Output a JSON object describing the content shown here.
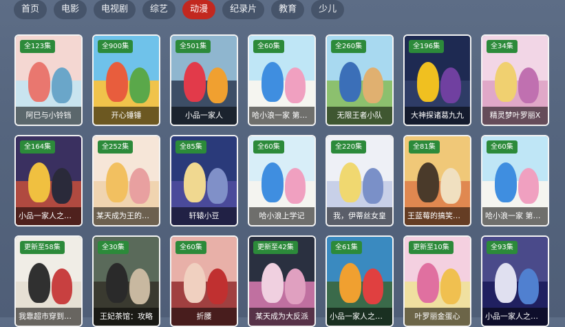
{
  "nav": {
    "tabs": [
      {
        "label": "首页"
      },
      {
        "label": "电影"
      },
      {
        "label": "电视剧"
      },
      {
        "label": "综艺"
      },
      {
        "label": "动漫",
        "active": true
      },
      {
        "label": "纪录片"
      },
      {
        "label": "教育"
      },
      {
        "label": "少儿"
      }
    ]
  },
  "accent_color": "#c2281f",
  "badge_color": "#2c8a3a",
  "cards": [
    {
      "badge": "全123集",
      "title": "阿巳与小铃铛",
      "sky": "#f4d7d2",
      "ground": "#c9e4ef",
      "f1": "#e9776f",
      "f2": "#6aa6c9"
    },
    {
      "badge": "全900集",
      "title": "开心锤锤",
      "sky": "#6fc2ea",
      "ground": "#f0c34b",
      "f1": "#e85d3d",
      "f2": "#5aa84a"
    },
    {
      "badge": "全501集",
      "title": "小品一家人",
      "sky": "#8fb6cf",
      "ground": "#3d4e66",
      "f1": "#e23a4a",
      "f2": "#f0a030"
    },
    {
      "badge": "全60集",
      "title": "哈小浪一家 第三季",
      "sky": "#bfe6f6",
      "ground": "#f5f5f0",
      "f1": "#3f8ee0",
      "f2": "#f0a0c0"
    },
    {
      "badge": "全260集",
      "title": "无限王者小队",
      "sky": "#a8d9f0",
      "ground": "#8cc06e",
      "f1": "#3b6fb8",
      "f2": "#e0b070"
    },
    {
      "badge": "全196集",
      "title": "大神探诸葛九九",
      "sky": "#1e2a52",
      "ground": "#2e3c66",
      "f1": "#f0c020",
      "f2": "#7040a0"
    },
    {
      "badge": "全34集",
      "title": "精灵梦叶罗丽X",
      "sky": "#f2d6e6",
      "ground": "#e0a8c8",
      "f1": "#f0d070",
      "f2": "#c070b0"
    },
    {
      "badge": "全164集",
      "title": "小品一家人之奇幻冒险",
      "sky": "#3a3060",
      "ground": "#b04a40",
      "f1": "#f0c040",
      "f2": "#2a2a3a"
    },
    {
      "badge": "全252集",
      "title": "某天成为王的女儿",
      "sky": "#f6e6d8",
      "ground": "#f0d4b0",
      "f1": "#f2c060",
      "f2": "#e8a0a0"
    },
    {
      "badge": "全85集",
      "title": "轩辕小豆",
      "sky": "#2a3a7a",
      "ground": "#4a4a9a",
      "f1": "#f0d890",
      "f2": "#8090c8"
    },
    {
      "badge": "全60集",
      "title": "哈小浪上学记",
      "sky": "#d8eef8",
      "ground": "#f4f4f0",
      "f1": "#3f8ee0",
      "f2": "#f0a0c0"
    },
    {
      "badge": "全220集",
      "title": "我，伊蒂丝女皇",
      "sky": "#eef0f6",
      "ground": "#c8d0e8",
      "f1": "#f0d870",
      "f2": "#7a90c8"
    },
    {
      "badge": "全81集",
      "title": "王蓝莓的搞笑日常",
      "sky": "#f0c878",
      "ground": "#e08850",
      "f1": "#4a3a2a",
      "f2": "#f0e0c0"
    },
    {
      "badge": "全60集",
      "title": "哈小浪一家 第二季",
      "sky": "#bfe6f6",
      "ground": "#f5f5f0",
      "f1": "#3f8ee0",
      "f2": "#f0a0c0"
    },
    {
      "badge": "更新至58集",
      "title": "我靠超市穿到古代",
      "sky": "#f0ede6",
      "ground": "#e6e0d4",
      "f1": "#303030",
      "f2": "#c84040"
    },
    {
      "badge": "全30集",
      "title": "王妃茶馆：攻略",
      "sky": "#5a6a5a",
      "ground": "#3a3a30",
      "f1": "#2a2a2a",
      "f2": "#c8b8a0"
    },
    {
      "badge": "全60集",
      "title": "折腰",
      "sky": "#e8b0a8",
      "ground": "#a04040",
      "f1": "#f0d0c0",
      "f2": "#c03030"
    },
    {
      "badge": "更新至42集",
      "title": "某天成为大反派",
      "sky": "#2a3040",
      "ground": "#c070a0",
      "f1": "#f0d0e0",
      "f2": "#e0a0c0"
    },
    {
      "badge": "全61集",
      "title": "小品一家人之穿越",
      "sky": "#3a8ac0",
      "ground": "#3a6a4a",
      "f1": "#f0a030",
      "f2": "#e04040"
    },
    {
      "badge": "更新至10集",
      "title": "叶罗丽金蛋心",
      "sky": "#f4d0e0",
      "ground": "#f0e0a0",
      "f1": "#e070a0",
      "f2": "#f0c050"
    },
    {
      "badge": "全93集",
      "title": "小品一家人之战斗",
      "sky": "#4a4a8a",
      "ground": "#202060",
      "f1": "#e0e0f0",
      "f2": "#5080d0"
    }
  ]
}
